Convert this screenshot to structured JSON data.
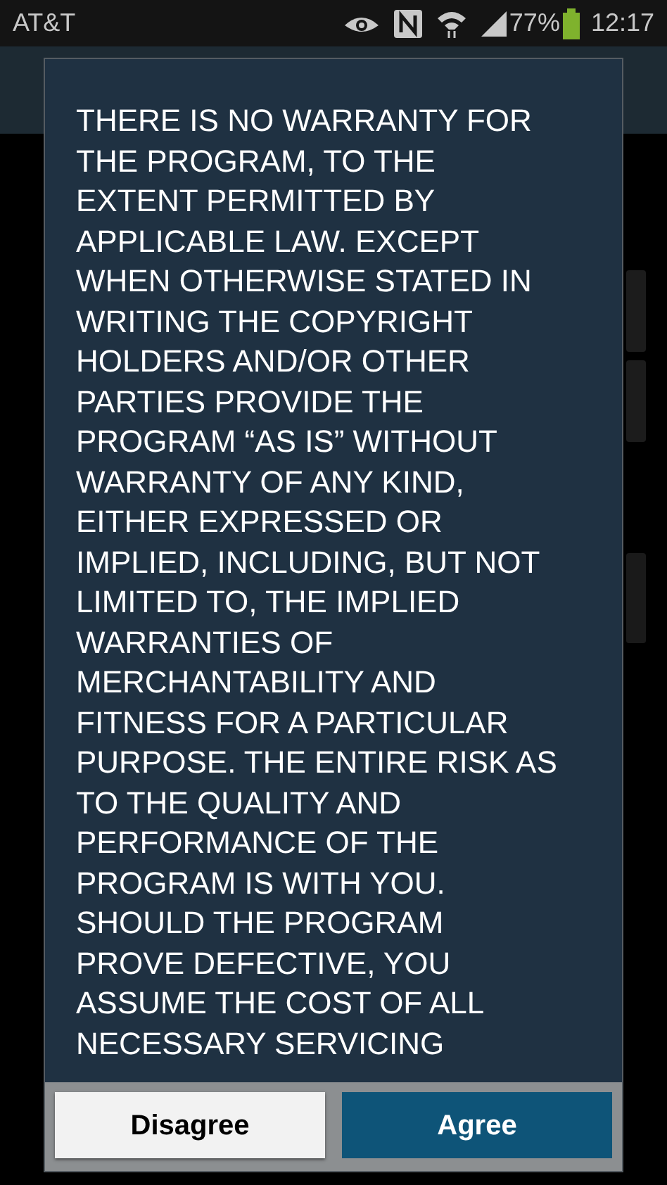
{
  "status_bar": {
    "carrier": "AT&T",
    "battery": "77%",
    "time": "12:17"
  },
  "dialog": {
    "message_lines": [
      "THERE IS NO WARRANTY FOR",
      "THE PROGRAM, TO THE",
      "EXTENT PERMITTED BY",
      "APPLICABLE LAW. EXCEPT",
      "WHEN OTHERWISE STATED IN",
      "WRITING THE COPYRIGHT",
      "HOLDERS AND/OR OTHER",
      "PARTIES PROVIDE THE",
      "PROGRAM “AS IS” WITHOUT",
      "WARRANTY OF ANY KIND,",
      "EITHER EXPRESSED OR",
      "IMPLIED, INCLUDING, BUT NOT",
      "LIMITED TO, THE IMPLIED",
      "WARRANTIES OF",
      "MERCHANTABILITY AND",
      "FITNESS FOR A PARTICULAR",
      "PURPOSE. THE ENTIRE RISK AS",
      "TO THE QUALITY AND",
      "PERFORMANCE OF THE",
      "PROGRAM IS WITH YOU.",
      "SHOULD THE PROGRAM",
      "PROVE DEFECTIVE, YOU",
      "ASSUME THE COST OF ALL",
      "NECESSARY SERVICING"
    ],
    "buttons": [
      {
        "label": "Disagree",
        "kind": "secondary"
      },
      {
        "label": "Agree",
        "kind": "primary"
      }
    ]
  }
}
